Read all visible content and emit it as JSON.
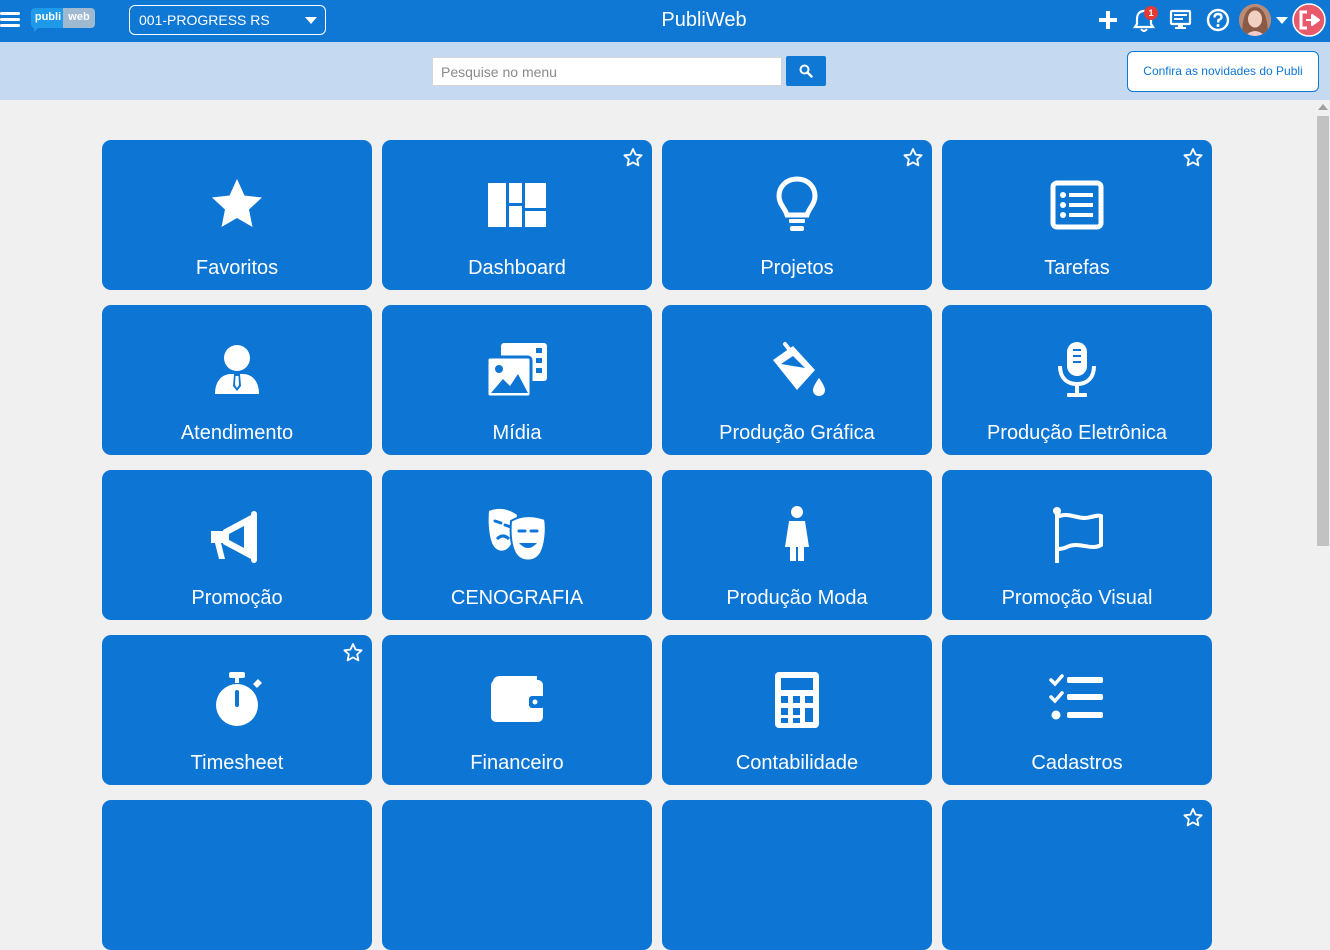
{
  "header": {
    "logo_left": "publi",
    "logo_right": "web",
    "company": "001-PROGRESS RS",
    "title": "PubliWeb",
    "notification_count": "1"
  },
  "search": {
    "placeholder": "Pesquise no menu",
    "value": "",
    "news_button": "Confira as novidades do Publi"
  },
  "colors": {
    "primary": "#0f77d4",
    "tile": "#0d75d3",
    "search_bg": "#c5daf0",
    "page_bg": "#f0f0f0",
    "badge": "#e53935",
    "logout": "#e8596a"
  },
  "tiles": [
    {
      "label": "Favoritos",
      "icon": "star-icon",
      "favorited": false
    },
    {
      "label": "Dashboard",
      "icon": "dashboard-icon",
      "favorited": true
    },
    {
      "label": "Projetos",
      "icon": "lightbulb-icon",
      "favorited": true
    },
    {
      "label": "Tarefas",
      "icon": "list-icon",
      "favorited": true
    },
    {
      "label": "Atendimento",
      "icon": "user-tie-icon",
      "favorited": false
    },
    {
      "label": "Mídia",
      "icon": "media-icon",
      "favorited": false
    },
    {
      "label": "Produção Gráfica",
      "icon": "paint-bucket-icon",
      "favorited": false
    },
    {
      "label": "Produção Eletrônica",
      "icon": "microphone-icon",
      "favorited": false
    },
    {
      "label": "Promoção",
      "icon": "megaphone-icon",
      "favorited": false
    },
    {
      "label": "CENOGRAFIA",
      "icon": "theater-masks-icon",
      "favorited": false
    },
    {
      "label": "Produção Moda",
      "icon": "female-icon",
      "favorited": false
    },
    {
      "label": "Promoção Visual",
      "icon": "flag-icon",
      "favorited": false
    },
    {
      "label": "Timesheet",
      "icon": "stopwatch-icon",
      "favorited": true
    },
    {
      "label": "Financeiro",
      "icon": "wallet-icon",
      "favorited": false
    },
    {
      "label": "Contabilidade",
      "icon": "calculator-icon",
      "favorited": false
    },
    {
      "label": "Cadastros",
      "icon": "checklist-icon",
      "favorited": false
    },
    {
      "label": "",
      "icon": "",
      "favorited": false
    },
    {
      "label": "",
      "icon": "",
      "favorited": false
    },
    {
      "label": "",
      "icon": "",
      "favorited": false
    },
    {
      "label": "",
      "icon": "",
      "favorited": true
    }
  ]
}
